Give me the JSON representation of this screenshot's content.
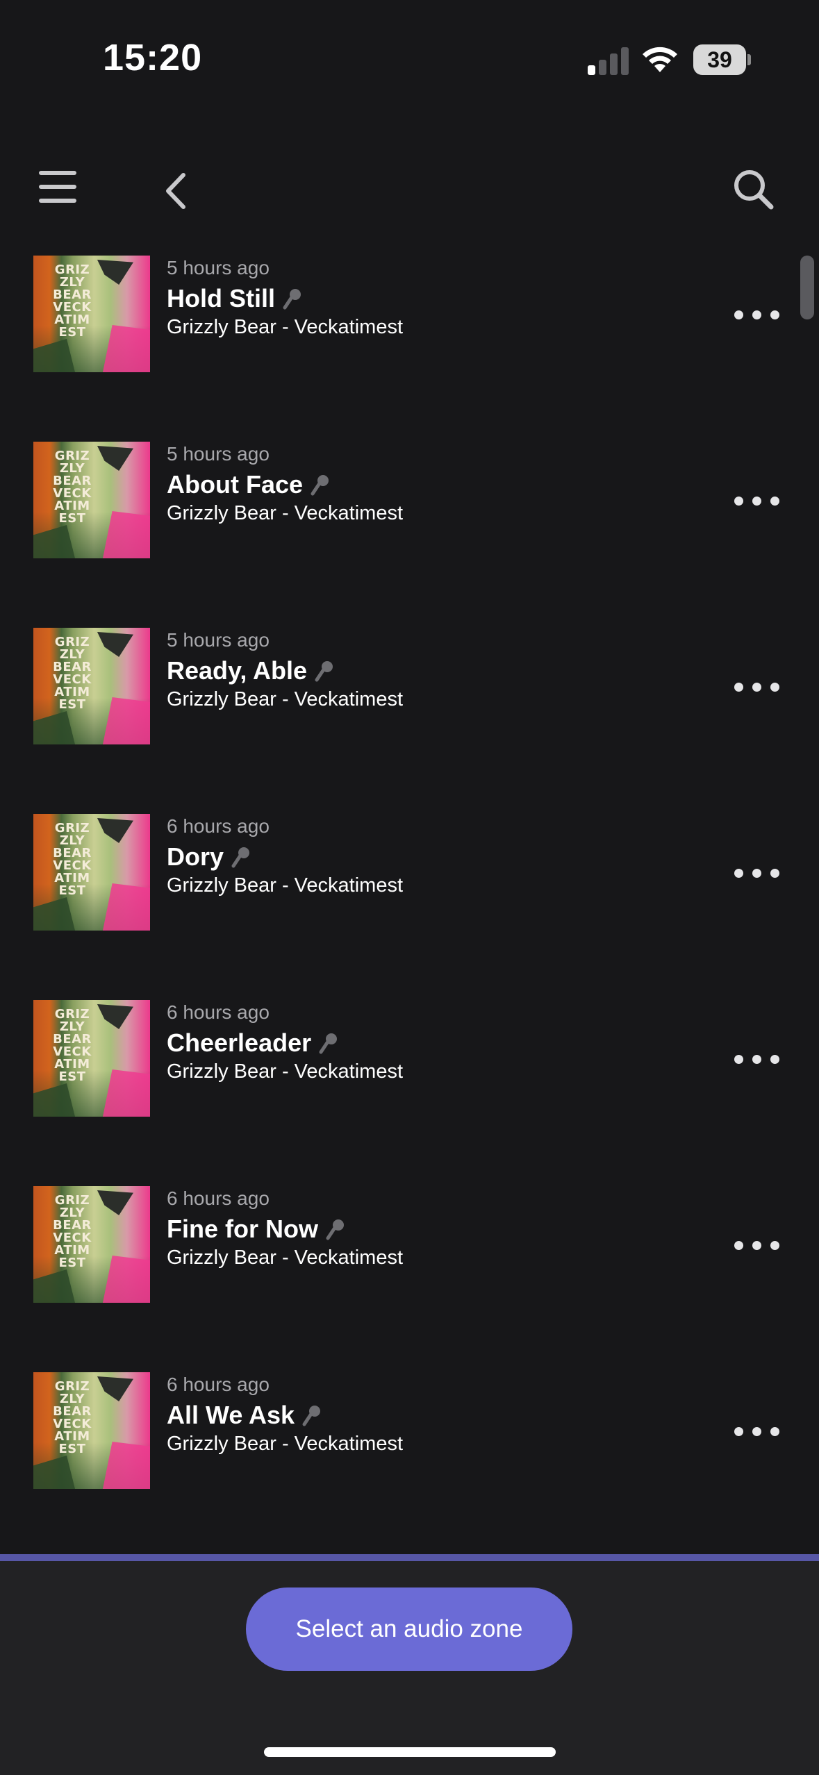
{
  "status_bar": {
    "time": "15:20",
    "battery_level": "39",
    "signal_bars_active": 1,
    "signal_bars_total": 4
  },
  "nav": {
    "menu_icon": "hamburger-menu-icon",
    "back_icon": "chevron-left-icon",
    "search_icon": "search-icon"
  },
  "tracks": [
    {
      "time_ago": "5 hours ago",
      "title": "Hold Still",
      "artist_album": "Grizzly Bear - Veckatimest"
    },
    {
      "time_ago": "5 hours ago",
      "title": "About Face",
      "artist_album": "Grizzly Bear - Veckatimest"
    },
    {
      "time_ago": "5 hours ago",
      "title": "Ready, Able",
      "artist_album": "Grizzly Bear - Veckatimest"
    },
    {
      "time_ago": "6 hours ago",
      "title": "Dory",
      "artist_album": "Grizzly Bear - Veckatimest"
    },
    {
      "time_ago": "6 hours ago",
      "title": "Cheerleader",
      "artist_album": "Grizzly Bear - Veckatimest"
    },
    {
      "time_ago": "6 hours ago",
      "title": "Fine for Now",
      "artist_album": "Grizzly Bear - Veckatimest"
    },
    {
      "time_ago": "6 hours ago",
      "title": "All We Ask",
      "artist_album": "Grizzly Bear - Veckatimest"
    }
  ],
  "album_art_text": "GRIZ ZLY BEAR VECK ATIM EST",
  "bottom": {
    "zone_button_label": "Select an audio zone"
  },
  "colors": {
    "background": "#171719",
    "accent": "#6b6bd6",
    "accent_line": "#5757a6",
    "secondary_text": "#a8a8ac"
  }
}
